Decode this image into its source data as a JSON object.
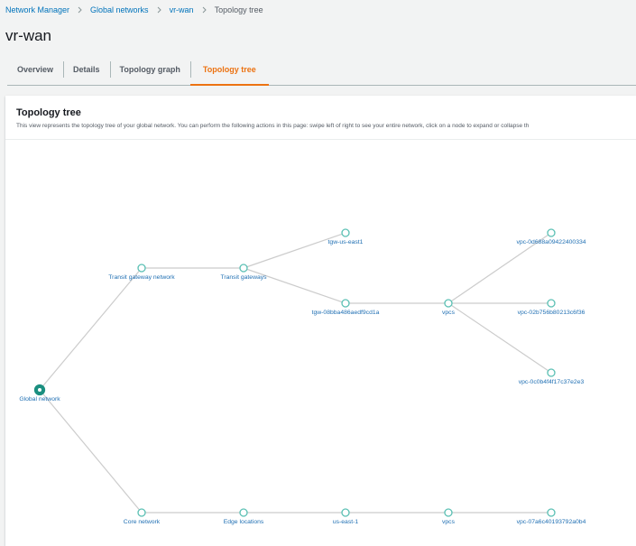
{
  "breadcrumb": {
    "items": [
      "Network Manager",
      "Global networks",
      "vr-wan"
    ],
    "current": "Topology tree"
  },
  "page": {
    "title": "vr-wan"
  },
  "tabs": [
    {
      "label": "Overview",
      "active": false
    },
    {
      "label": "Details",
      "active": false
    },
    {
      "label": "Topology graph",
      "active": false
    },
    {
      "label": "Topology tree",
      "active": true
    }
  ],
  "panel": {
    "title": "Topology tree",
    "description": "This view represents the topology tree of your global network. You can perform the following actions in this page: swipe left of right to see your entire network, click on a node to expand or collapse th"
  },
  "tree": {
    "nodes": [
      {
        "id": "global",
        "label": "Global network",
        "root": true
      },
      {
        "id": "tgwnet",
        "label": "Transit gateway network"
      },
      {
        "id": "core",
        "label": "Core network"
      },
      {
        "id": "tgws",
        "label": "Transit gateways"
      },
      {
        "id": "edge",
        "label": "Edge locations"
      },
      {
        "id": "tgwuse1",
        "label": "tgw-us-east1"
      },
      {
        "id": "tgw08",
        "label": "tgw-08bba486aedf9cd1a"
      },
      {
        "id": "useast1",
        "label": "us-east-1"
      },
      {
        "id": "vpcs1",
        "label": "vpcs"
      },
      {
        "id": "vpcs2",
        "label": "vpcs"
      },
      {
        "id": "vpc0d",
        "label": "vpc-0d688a09422400334"
      },
      {
        "id": "vpc02",
        "label": "vpc-02b756b80213c6f36"
      },
      {
        "id": "vpc0c",
        "label": "vpc-0c0b4f4f17c37e2e3"
      },
      {
        "id": "vpc07",
        "label": "vpc-07a6c40193792a0b4"
      }
    ],
    "links": [
      [
        "global",
        "tgwnet"
      ],
      [
        "global",
        "core"
      ],
      [
        "tgwnet",
        "tgws"
      ],
      [
        "tgws",
        "tgwuse1"
      ],
      [
        "tgws",
        "tgw08"
      ],
      [
        "tgw08",
        "vpcs1"
      ],
      [
        "vpcs1",
        "vpc0d"
      ],
      [
        "vpcs1",
        "vpc02"
      ],
      [
        "vpcs1",
        "vpc0c"
      ],
      [
        "core",
        "edge"
      ],
      [
        "edge",
        "useast1"
      ],
      [
        "useast1",
        "vpcs2"
      ],
      [
        "vpcs2",
        "vpc07"
      ]
    ]
  }
}
